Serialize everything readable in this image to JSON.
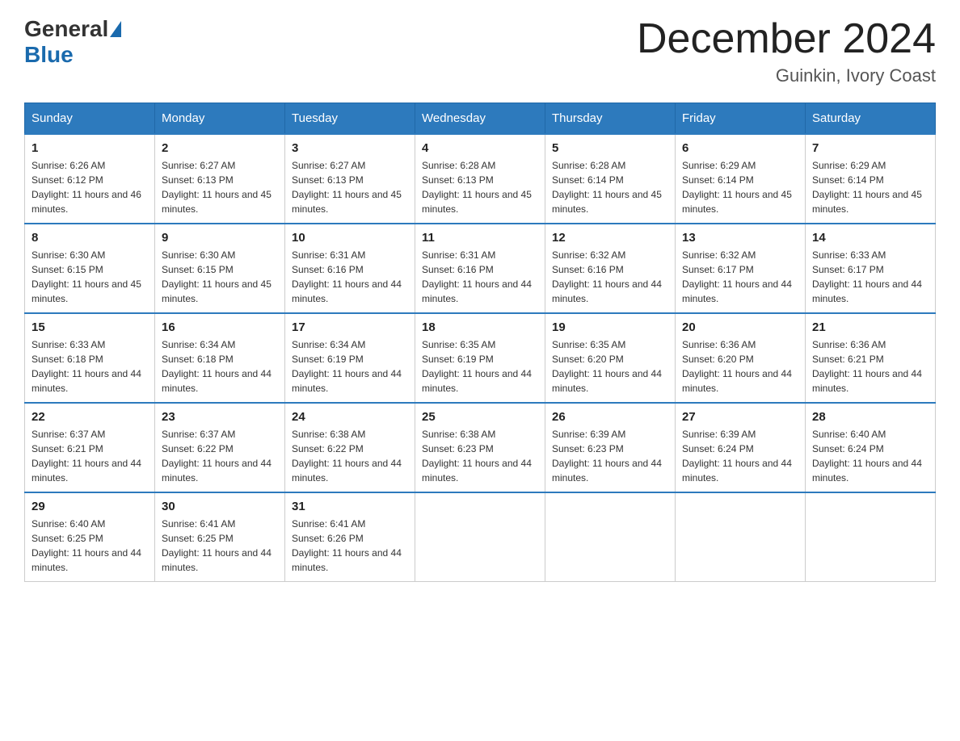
{
  "header": {
    "title": "December 2024",
    "location": "Guinkin, Ivory Coast",
    "logo_general": "General",
    "logo_blue": "Blue"
  },
  "days_of_week": [
    "Sunday",
    "Monday",
    "Tuesday",
    "Wednesday",
    "Thursday",
    "Friday",
    "Saturday"
  ],
  "weeks": [
    [
      {
        "day": 1,
        "sunrise": "6:26 AM",
        "sunset": "6:12 PM",
        "daylight": "11 hours and 46 minutes."
      },
      {
        "day": 2,
        "sunrise": "6:27 AM",
        "sunset": "6:13 PM",
        "daylight": "11 hours and 45 minutes."
      },
      {
        "day": 3,
        "sunrise": "6:27 AM",
        "sunset": "6:13 PM",
        "daylight": "11 hours and 45 minutes."
      },
      {
        "day": 4,
        "sunrise": "6:28 AM",
        "sunset": "6:13 PM",
        "daylight": "11 hours and 45 minutes."
      },
      {
        "day": 5,
        "sunrise": "6:28 AM",
        "sunset": "6:14 PM",
        "daylight": "11 hours and 45 minutes."
      },
      {
        "day": 6,
        "sunrise": "6:29 AM",
        "sunset": "6:14 PM",
        "daylight": "11 hours and 45 minutes."
      },
      {
        "day": 7,
        "sunrise": "6:29 AM",
        "sunset": "6:14 PM",
        "daylight": "11 hours and 45 minutes."
      }
    ],
    [
      {
        "day": 8,
        "sunrise": "6:30 AM",
        "sunset": "6:15 PM",
        "daylight": "11 hours and 45 minutes."
      },
      {
        "day": 9,
        "sunrise": "6:30 AM",
        "sunset": "6:15 PM",
        "daylight": "11 hours and 45 minutes."
      },
      {
        "day": 10,
        "sunrise": "6:31 AM",
        "sunset": "6:16 PM",
        "daylight": "11 hours and 44 minutes."
      },
      {
        "day": 11,
        "sunrise": "6:31 AM",
        "sunset": "6:16 PM",
        "daylight": "11 hours and 44 minutes."
      },
      {
        "day": 12,
        "sunrise": "6:32 AM",
        "sunset": "6:16 PM",
        "daylight": "11 hours and 44 minutes."
      },
      {
        "day": 13,
        "sunrise": "6:32 AM",
        "sunset": "6:17 PM",
        "daylight": "11 hours and 44 minutes."
      },
      {
        "day": 14,
        "sunrise": "6:33 AM",
        "sunset": "6:17 PM",
        "daylight": "11 hours and 44 minutes."
      }
    ],
    [
      {
        "day": 15,
        "sunrise": "6:33 AM",
        "sunset": "6:18 PM",
        "daylight": "11 hours and 44 minutes."
      },
      {
        "day": 16,
        "sunrise": "6:34 AM",
        "sunset": "6:18 PM",
        "daylight": "11 hours and 44 minutes."
      },
      {
        "day": 17,
        "sunrise": "6:34 AM",
        "sunset": "6:19 PM",
        "daylight": "11 hours and 44 minutes."
      },
      {
        "day": 18,
        "sunrise": "6:35 AM",
        "sunset": "6:19 PM",
        "daylight": "11 hours and 44 minutes."
      },
      {
        "day": 19,
        "sunrise": "6:35 AM",
        "sunset": "6:20 PM",
        "daylight": "11 hours and 44 minutes."
      },
      {
        "day": 20,
        "sunrise": "6:36 AM",
        "sunset": "6:20 PM",
        "daylight": "11 hours and 44 minutes."
      },
      {
        "day": 21,
        "sunrise": "6:36 AM",
        "sunset": "6:21 PM",
        "daylight": "11 hours and 44 minutes."
      }
    ],
    [
      {
        "day": 22,
        "sunrise": "6:37 AM",
        "sunset": "6:21 PM",
        "daylight": "11 hours and 44 minutes."
      },
      {
        "day": 23,
        "sunrise": "6:37 AM",
        "sunset": "6:22 PM",
        "daylight": "11 hours and 44 minutes."
      },
      {
        "day": 24,
        "sunrise": "6:38 AM",
        "sunset": "6:22 PM",
        "daylight": "11 hours and 44 minutes."
      },
      {
        "day": 25,
        "sunrise": "6:38 AM",
        "sunset": "6:23 PM",
        "daylight": "11 hours and 44 minutes."
      },
      {
        "day": 26,
        "sunrise": "6:39 AM",
        "sunset": "6:23 PM",
        "daylight": "11 hours and 44 minutes."
      },
      {
        "day": 27,
        "sunrise": "6:39 AM",
        "sunset": "6:24 PM",
        "daylight": "11 hours and 44 minutes."
      },
      {
        "day": 28,
        "sunrise": "6:40 AM",
        "sunset": "6:24 PM",
        "daylight": "11 hours and 44 minutes."
      }
    ],
    [
      {
        "day": 29,
        "sunrise": "6:40 AM",
        "sunset": "6:25 PM",
        "daylight": "11 hours and 44 minutes."
      },
      {
        "day": 30,
        "sunrise": "6:41 AM",
        "sunset": "6:25 PM",
        "daylight": "11 hours and 44 minutes."
      },
      {
        "day": 31,
        "sunrise": "6:41 AM",
        "sunset": "6:26 PM",
        "daylight": "11 hours and 44 minutes."
      },
      null,
      null,
      null,
      null
    ]
  ]
}
